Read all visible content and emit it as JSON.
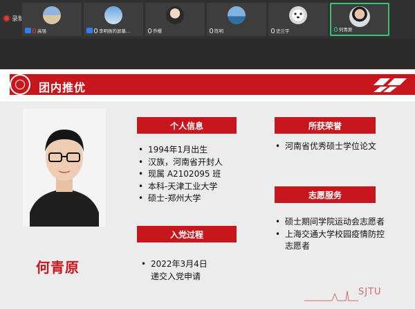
{
  "meeting": {
    "recording_label": "录制中",
    "participants": [
      {
        "name": "高强",
        "thumb": "beach",
        "badge": true,
        "mic": "red"
      },
      {
        "name": "李明扬的屏幕...",
        "thumb": "sky",
        "badge": true,
        "mic": "white"
      },
      {
        "name": "乔樱",
        "thumb": "girl",
        "badge": false,
        "mic": "white"
      },
      {
        "name": "陈明",
        "thumb": "ocean",
        "badge": false,
        "mic": "white"
      },
      {
        "name": "史兰宇",
        "thumb": "dog",
        "badge": false,
        "mic": "white"
      },
      {
        "name": "何青原",
        "thumb": "man",
        "badge": false,
        "mic": "green",
        "active": true
      }
    ]
  },
  "slide": {
    "title": "团内推优",
    "name": "何青原",
    "personal_info": {
      "heading": "个人信息",
      "items": [
        "1994年1月出生",
        "汉族，河南省开封人",
        "现属 A2102095 班",
        "本科-天津工业大学",
        "硕士-郑州大学"
      ]
    },
    "party": {
      "heading": "入党过程",
      "items": [
        "2022年3月4日\n递交入党申请"
      ]
    },
    "honors": {
      "heading": "所获荣誉",
      "items": [
        "河南省优秀硕士学位论文"
      ]
    },
    "volunteer": {
      "heading": "志愿服务",
      "items": [
        "硕士期间学院运动会志愿者",
        "上海交通大学校园疫情防控志愿者"
      ]
    },
    "footer_brand": "SJTU"
  },
  "colors": {
    "accent": "#c8161d",
    "slide_bg": "#ececec",
    "bar_bg": "#303030"
  }
}
